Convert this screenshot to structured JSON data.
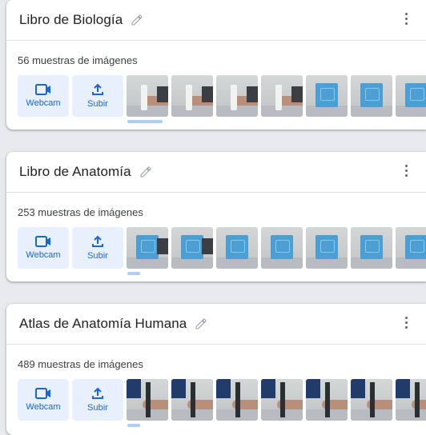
{
  "cards": [
    {
      "title": "Libro de Biología",
      "count": "56 muestras de imágenes",
      "webcam_label": "Webcam",
      "upload_label": "Subir",
      "thumbs": [
        "paper",
        "paper",
        "paper",
        "paper",
        "book",
        "book",
        "book"
      ]
    },
    {
      "title": "Libro de Anatomía",
      "count": "253 muestras de imágenes",
      "webcam_label": "Webcam",
      "upload_label": "Subir",
      "thumbs": [
        "book",
        "book",
        "book",
        "book",
        "book",
        "book",
        "book"
      ]
    },
    {
      "title": "Atlas de Anatomía Humana",
      "count": "489 muestras de imágenes",
      "webcam_label": "Webcam",
      "upload_label": "Subir",
      "thumbs": [
        "stand",
        "stand",
        "stand",
        "stand",
        "stand",
        "stand",
        "stand"
      ]
    }
  ],
  "icons": {
    "edit": "pencil-icon",
    "menu": "more-vert-icon",
    "webcam": "videocam-icon",
    "upload": "upload-icon"
  },
  "colors": {
    "accent": "#1967d2",
    "button_bg": "#e8f0fe",
    "scrollbar": "#aecbfa"
  }
}
